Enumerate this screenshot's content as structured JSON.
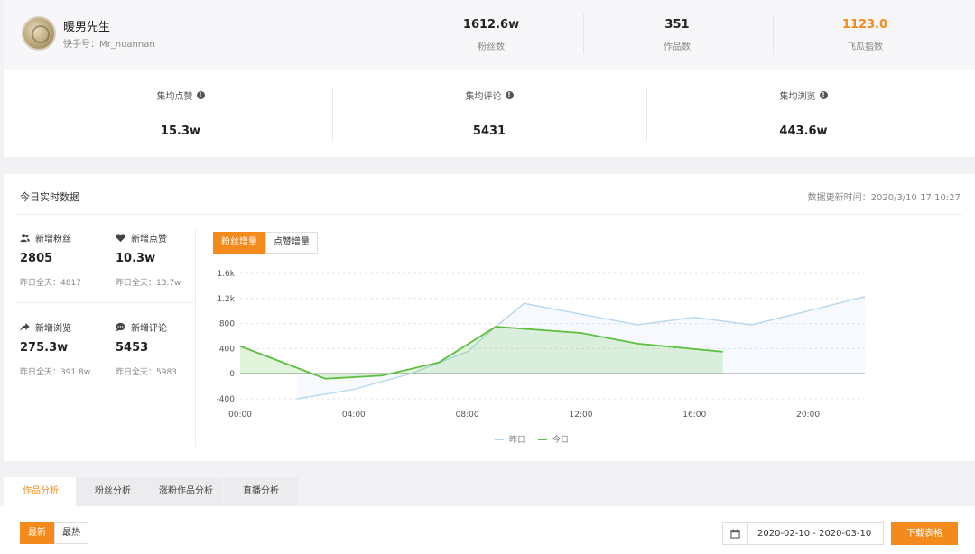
{
  "profile": {
    "name": "暖男先生",
    "handle": "快手号：Mr_nuannan",
    "stats": [
      {
        "value": "1612.6w",
        "label": "粉丝数",
        "highlight": false
      },
      {
        "value": "351",
        "label": "作品数",
        "highlight": false
      },
      {
        "value": "1123.0",
        "label": "飞瓜指数",
        "highlight": true
      }
    ]
  },
  "averages": [
    {
      "label": "集均点赞",
      "value": "15.3w"
    },
    {
      "label": "集均评论",
      "value": "5431"
    },
    {
      "label": "集均浏览",
      "value": "443.6w"
    }
  ],
  "realtime": {
    "title": "今日实时数据",
    "updated": "数据更新时间：2020/3/10 17:10:27",
    "metrics": [
      {
        "icon": "users-icon",
        "label": "新增粉丝",
        "value": "2805",
        "prev": "昨日全天：4817"
      },
      {
        "icon": "heart-icon",
        "label": "新增点赞",
        "value": "10.3w",
        "prev": "昨日全天：13.7w"
      },
      {
        "icon": "share-arrow-icon",
        "label": "新增浏览",
        "value": "275.3w",
        "prev": "昨日全天：391.8w"
      },
      {
        "icon": "comment-icon",
        "label": "新增评论",
        "value": "5453",
        "prev": "昨日全天：5983"
      }
    ],
    "toggles": [
      {
        "label": "粉丝增量",
        "active": true
      },
      {
        "label": "点赞增量",
        "active": false
      }
    ]
  },
  "chart_data": {
    "type": "line",
    "y_ticks": [
      -400,
      0,
      400,
      800,
      1200,
      1600
    ],
    "y_tick_labels": [
      "-400",
      "0",
      "400",
      "800",
      "1.2k",
      "1.6k"
    ],
    "x_ticks": [
      0,
      4,
      8,
      12,
      16,
      20
    ],
    "x_tick_labels": [
      "00:00",
      "04:00",
      "08:00",
      "12:00",
      "16:00",
      "20:00"
    ],
    "xlim": [
      0,
      22
    ],
    "ylim": [
      -400,
      1600
    ],
    "legend": "bottom",
    "series": [
      {
        "name": "昨日",
        "color": "#b9d9f3",
        "points": [
          [
            2,
            -400
          ],
          [
            4,
            -250
          ],
          [
            6,
            0
          ],
          [
            8,
            350
          ],
          [
            9,
            750
          ],
          [
            10,
            1120
          ],
          [
            12,
            950
          ],
          [
            14,
            780
          ],
          [
            16,
            900
          ],
          [
            18,
            780
          ],
          [
            20,
            1000
          ],
          [
            22,
            1230
          ]
        ]
      },
      {
        "name": "今日",
        "color": "#5dbf3e",
        "points": [
          [
            0,
            440
          ],
          [
            3,
            -80
          ],
          [
            5,
            -30
          ],
          [
            7,
            180
          ],
          [
            9,
            750
          ],
          [
            12,
            650
          ],
          [
            14,
            480
          ],
          [
            17,
            350
          ]
        ]
      }
    ]
  },
  "tabs": [
    {
      "label": "作品分析",
      "active": true
    },
    {
      "label": "粉丝分析",
      "active": false
    },
    {
      "label": "涨粉作品分析",
      "active": false
    },
    {
      "label": "直播分析",
      "active": false
    }
  ],
  "toolbar": {
    "sort": [
      {
        "label": "最新",
        "active": true
      },
      {
        "label": "最热",
        "active": false
      }
    ],
    "date_range": "2020-02-10 - 2020-03-10",
    "download_label": "下载表格"
  },
  "colors": {
    "accent": "#f48a1b"
  }
}
